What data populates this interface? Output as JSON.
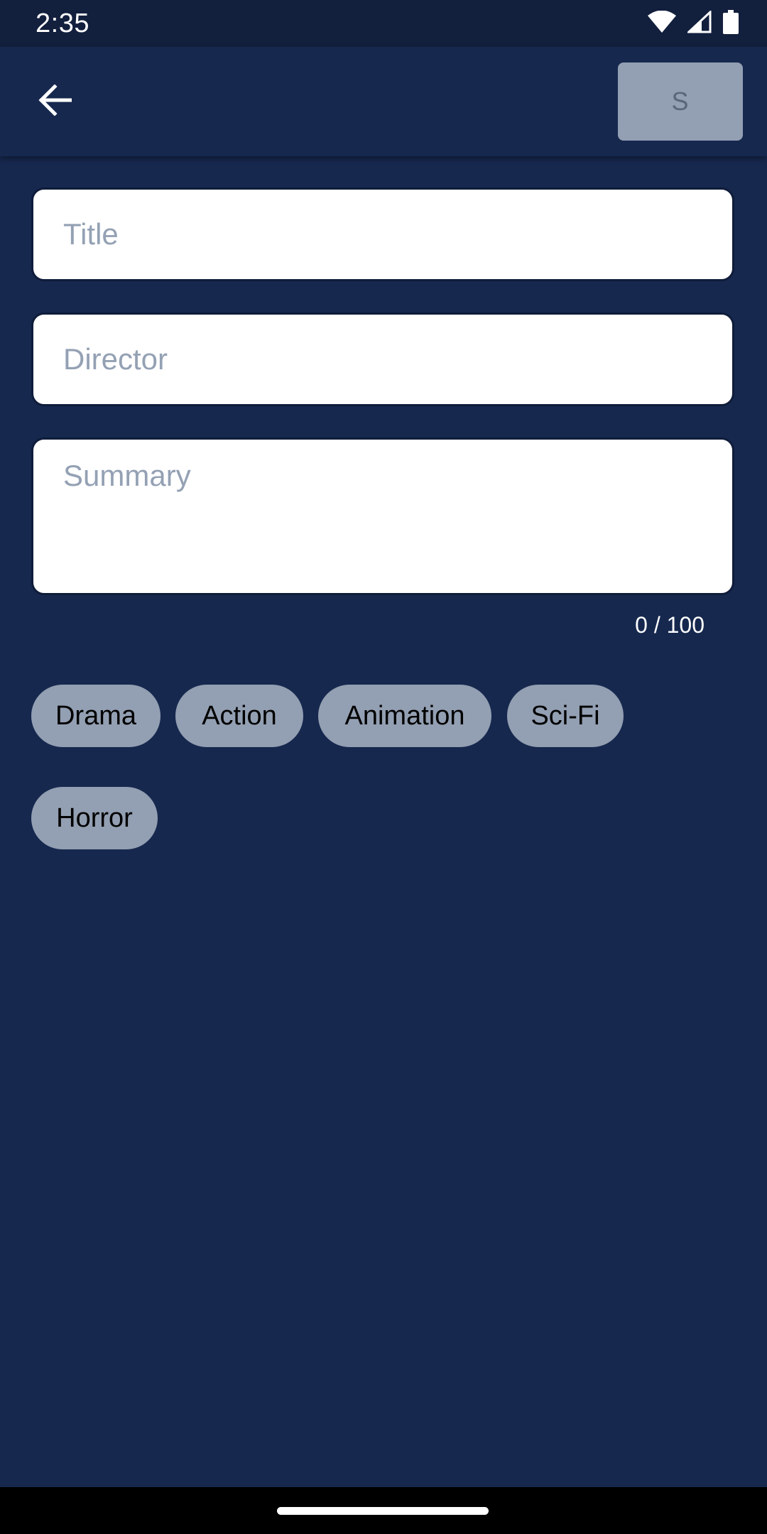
{
  "status_bar": {
    "time": "2:35",
    "icons": [
      "wifi-icon",
      "cell-signal-icon",
      "battery-icon"
    ]
  },
  "app_bar": {
    "back_icon": "arrow-left-icon",
    "save_label": "S"
  },
  "form": {
    "title_placeholder": "Title",
    "director_placeholder": "Director",
    "summary_placeholder": "Summary",
    "summary_counter": "0 / 100"
  },
  "genres": [
    "Drama",
    "Action",
    "Animation",
    "Sci-Fi",
    "Horror"
  ],
  "colors": {
    "background": "#16284e",
    "status_bar": "#121f3d",
    "chip": "#939fb2",
    "field": "#ffffff",
    "placeholder": "#94a1b4"
  }
}
